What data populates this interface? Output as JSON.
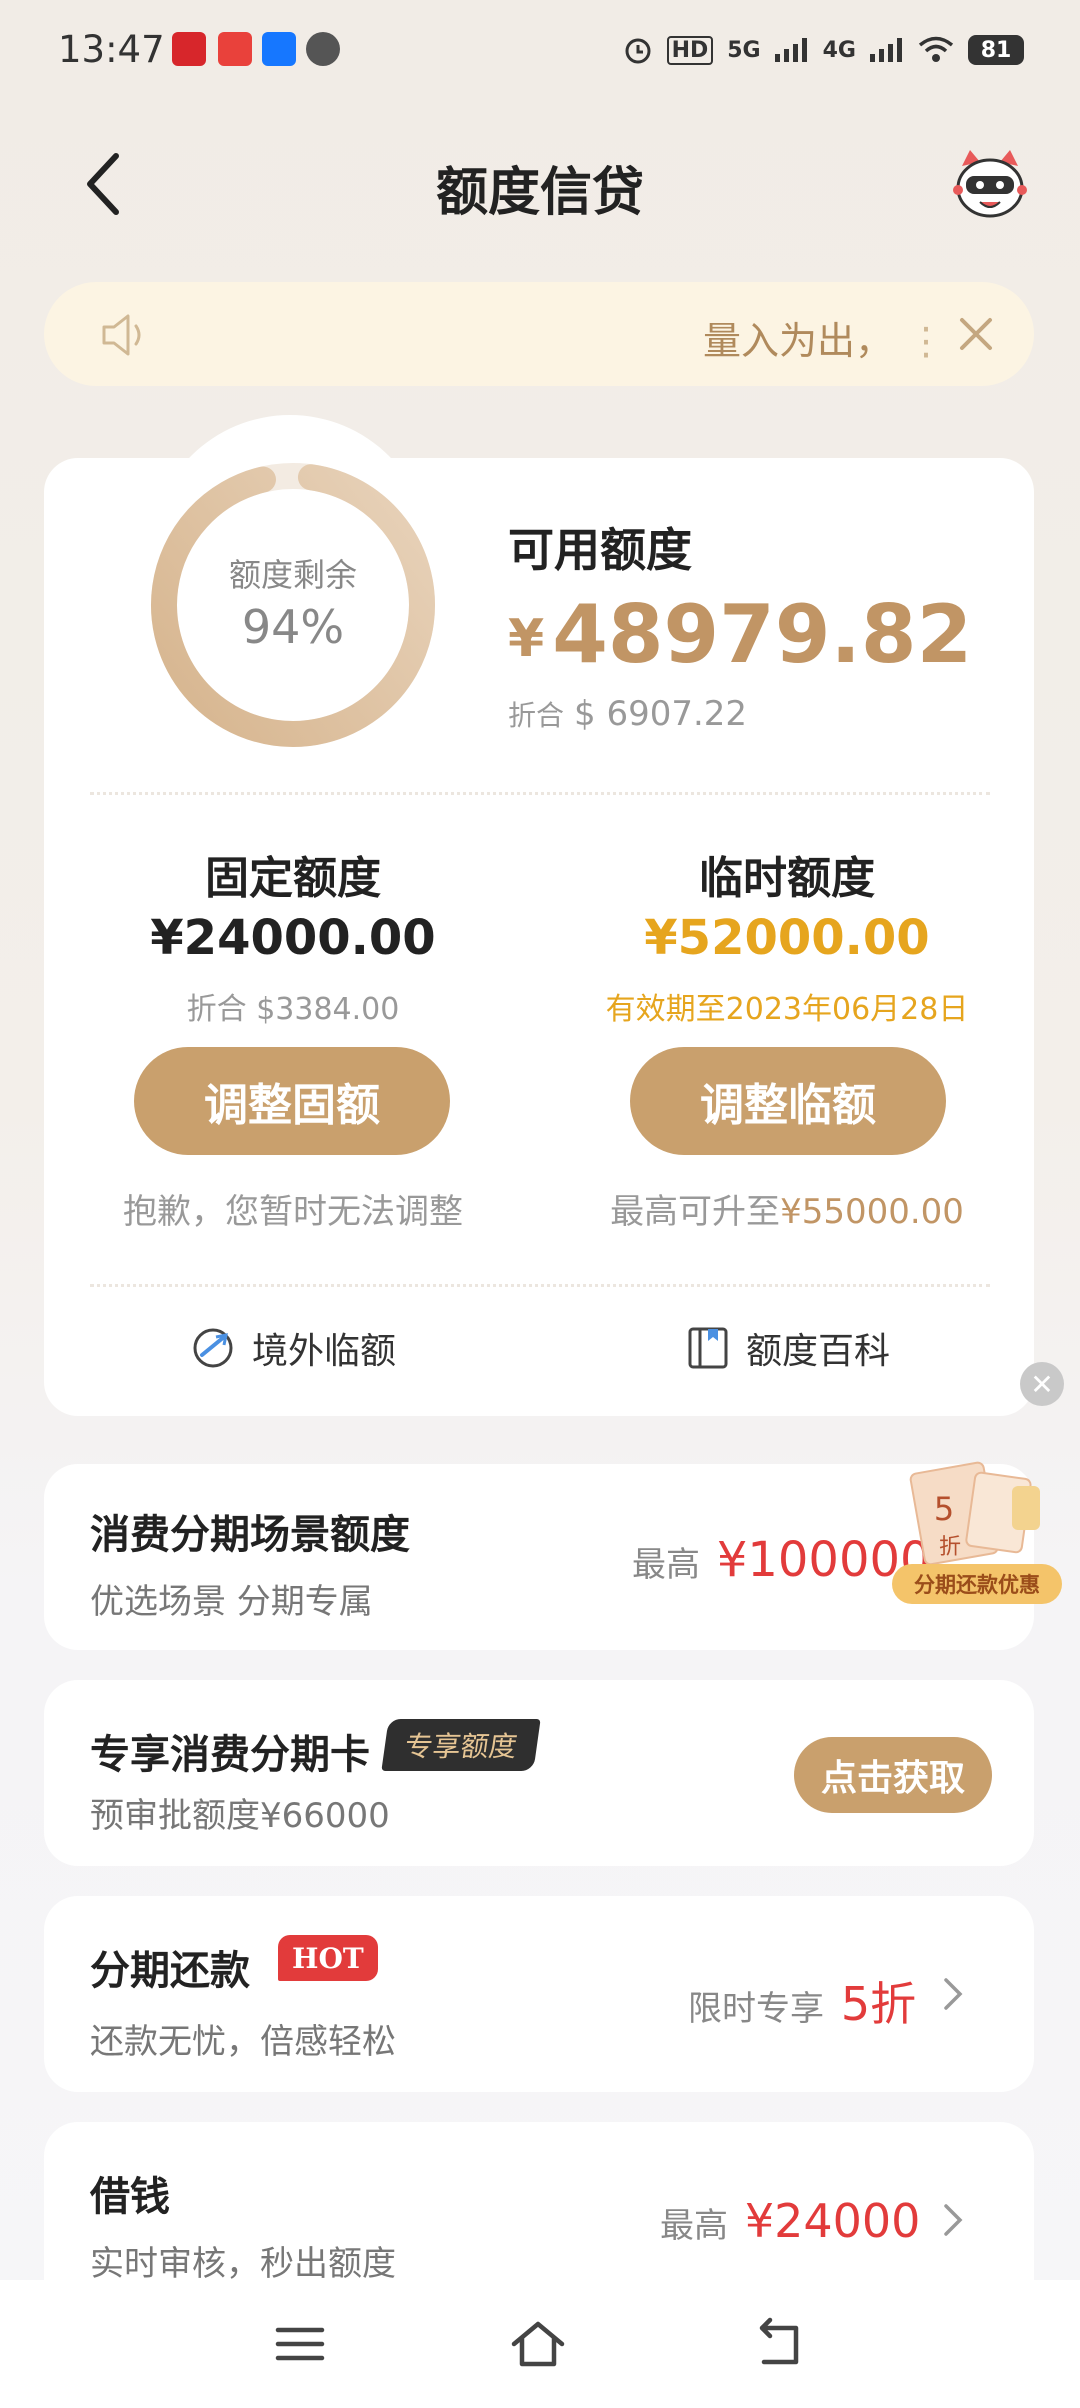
{
  "status_bar": {
    "time": "13:47",
    "battery": "81",
    "network": [
      "5G",
      "4G"
    ]
  },
  "header": {
    "title": "额度信贷"
  },
  "notice": {
    "text": "量入为出，"
  },
  "credit": {
    "ring_label": "额度剩余",
    "ring_percent": "94%",
    "ring_fraction": 0.94,
    "available_title": "可用额度",
    "currency_symbol": "¥",
    "available_amount": "48979.82",
    "usd_label": "折合",
    "usd_amount": "$ 6907.22"
  },
  "fixed_quota": {
    "title": "固定额度",
    "amount": "¥24000.00",
    "usd": "折合 $3384.00",
    "button": "调整固额",
    "note": "抱歉，您暂时无法调整"
  },
  "temp_quota": {
    "title": "临时额度",
    "amount": "¥52000.00",
    "validity": "有效期至2023年06月28日",
    "button": "调整临额",
    "note_prefix": "最高可升至",
    "note_amount": "¥55000.00"
  },
  "links": {
    "overseas": "境外临额",
    "encyclopedia": "额度百科"
  },
  "installment_scene": {
    "title": "消费分期场景额度",
    "subtitle": "优选场景 分期专属",
    "right_label": "最高",
    "right_amount": "¥100000"
  },
  "promo": {
    "discount_num": "5",
    "discount_unit": "折",
    "caption": "分期还款优惠"
  },
  "exclusive_card": {
    "title": "专享消费分期卡",
    "tag": "专享额度",
    "subtitle": "预审批额度¥66000",
    "button": "点击获取"
  },
  "installment_repay": {
    "title": "分期还款",
    "tag": "HOT",
    "subtitle": "还款无忧，倍感轻松",
    "right_label": "限时专享",
    "right_value": "5折"
  },
  "borrow": {
    "title": "借钱",
    "subtitle": "实时审核，秒出额度",
    "right_label": "最高",
    "right_amount": "¥24000"
  },
  "colors": {
    "accent": "#c9a06d",
    "accent_text": "#c19565",
    "gold": "#e6a51e",
    "red": "#e23b3b"
  }
}
